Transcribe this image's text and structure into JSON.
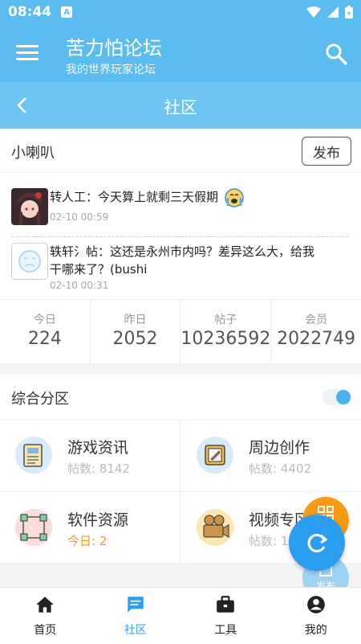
{
  "status_bar": {
    "time": "08:44",
    "notif_letter": "A"
  },
  "app_bar": {
    "title": "苦力怕论坛",
    "subtitle": "我的世界玩家论坛"
  },
  "sub_bar": {
    "title": "社区"
  },
  "feed": {
    "title": "小喇叭",
    "post_button": "发布",
    "items": [
      {
        "text": "转人工：今天算上就剩三天假期",
        "time": "02-10 00:59"
      },
      {
        "text": "轶轩氵帖：这还是永州市内吗？差异这么大，给我干哪来了？(bushi",
        "time": "02-10 00:31"
      }
    ]
  },
  "stats": [
    {
      "label": "今日",
      "value": "224"
    },
    {
      "label": "昨日",
      "value": "2052"
    },
    {
      "label": "帖子",
      "value": "10236592"
    },
    {
      "label": "会员",
      "value": "2022749"
    }
  ],
  "section": {
    "title": "综合分区",
    "toggle_on": true,
    "forums": [
      {
        "name": "游戏资讯",
        "count": "帖数: 8142",
        "icon": "newspaper-icon"
      },
      {
        "name": "周边创作",
        "count": "帖数: 4402",
        "icon": "pencil-frame-icon"
      },
      {
        "name": "软件资源",
        "count": "今日: 2",
        "icon": "network-nodes-icon"
      },
      {
        "name": "视频专区",
        "count": "帖数: 1",
        "icon": "video-camera-icon"
      }
    ]
  },
  "fab": {
    "post_label": "发布"
  },
  "bottom_nav": [
    {
      "label": "首页",
      "icon": "home-icon"
    },
    {
      "label": "社区",
      "icon": "chat-icon"
    },
    {
      "label": "工具",
      "icon": "toolbox-icon"
    },
    {
      "label": "我的",
      "icon": "user-icon"
    }
  ],
  "colors": {
    "primary": "#5bbcf0",
    "accent": "#2c9ef2",
    "orange": "#fa9a14",
    "today": "#f0a020"
  }
}
